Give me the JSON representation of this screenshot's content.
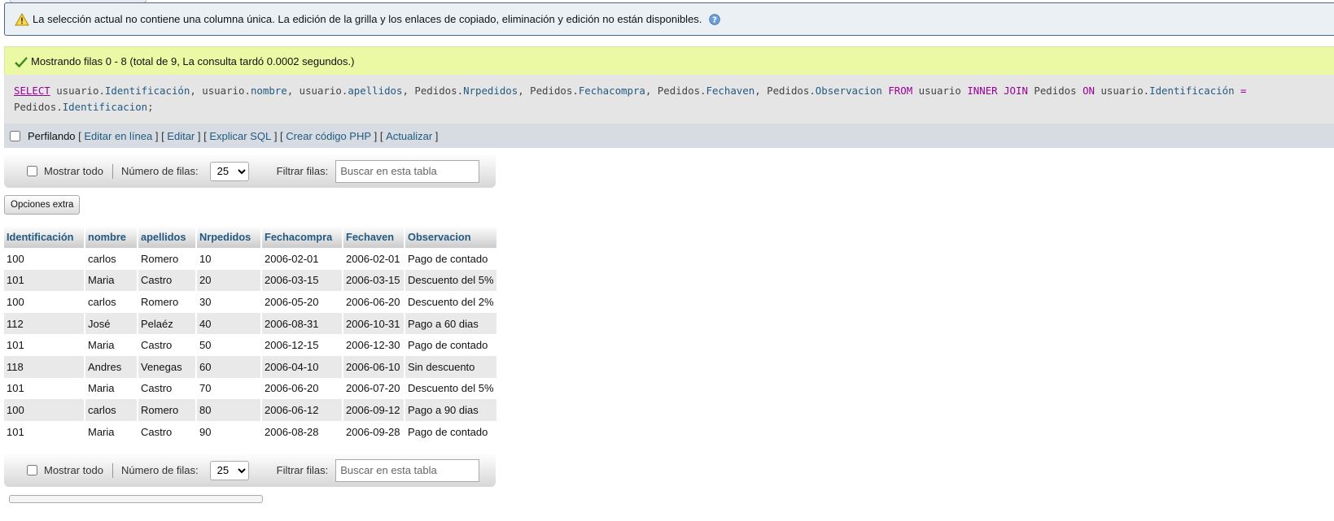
{
  "notice": {
    "text": "La selección actual no contiene una columna única. La edición de la grilla y los enlaces de copiado, eliminación y edición no están disponibles."
  },
  "success": {
    "text": "Mostrando filas 0 - 8 (total de 9, La consulta tardó 0.0002 segundos.)"
  },
  "sql": {
    "t1": "SELECT",
    "t2": " usuario.",
    "t3": "Identificación",
    "t4": ", usuario.",
    "t5": "nombre",
    "t6": ", usuario.",
    "t7": "apellidos",
    "t8": ", Pedidos.",
    "t9": "Nrpedidos",
    "t10": ", Pedidos.",
    "t11": "Fechacompra",
    "t12": ", Pedidos.",
    "t13": "Fechaven",
    "t14": ", Pedidos.",
    "t15": "Observacion",
    "t16": " FROM",
    "t17": " usuario ",
    "t18": "INNER JOIN",
    "t19": " Pedidos ",
    "t20": "ON",
    "t21": " usuario.",
    "t22": "Identificación",
    "t23": " =",
    "t24": "Pedidos.",
    "t25": "Identificacion",
    "t26": ";"
  },
  "profiling": {
    "label": "Perfilando",
    "links": [
      "Editar en línea",
      "Editar",
      "Explicar SQL",
      "Crear código PHP",
      "Actualizar"
    ]
  },
  "nav": {
    "show_all": "Mostrar todo",
    "rows_label": "Número de filas:",
    "rows_value": "25",
    "filter_label": "Filtrar filas:",
    "filter_placeholder": "Buscar en esta tabla"
  },
  "extra_options": "Opciones extra",
  "table": {
    "headers": [
      "Identificación",
      "nombre",
      "apellidos",
      "Nrpedidos",
      "Fechacompra",
      "Fechaven",
      "Observacion"
    ],
    "rows": [
      [
        "100",
        "carlos",
        "Romero",
        "10",
        "2006-02-01",
        "2006-02-01",
        "Pago de contado"
      ],
      [
        "101",
        "Maria",
        "Castro",
        "20",
        "2006-03-15",
        "2006-03-15",
        "Descuento del 5%"
      ],
      [
        "100",
        "carlos",
        "Romero",
        "30",
        "2006-05-20",
        "2006-06-20",
        "Descuento del 2%"
      ],
      [
        "112",
        "José",
        "Pelaéz",
        "40",
        "2006-08-31",
        "2006-10-31",
        "Pago a 60 dias"
      ],
      [
        "101",
        "Maria",
        "Castro",
        "50",
        "2006-12-15",
        "2006-12-30",
        "Pago de contado"
      ],
      [
        "118",
        "Andres",
        "Venegas",
        "60",
        "2006-04-10",
        "2006-06-10",
        "Sin descuento"
      ],
      [
        "101",
        "Maria",
        "Castro",
        "70",
        "2006-06-20",
        "2006-07-20",
        "Descuento del 5%"
      ],
      [
        "100",
        "carlos",
        "Romero",
        "80",
        "2006-06-12",
        "2006-09-12",
        "Pago a 90 dias"
      ],
      [
        "101",
        "Maria",
        "Castro",
        "90",
        "2006-08-28",
        "2006-09-28",
        "Pago de contado"
      ]
    ]
  }
}
